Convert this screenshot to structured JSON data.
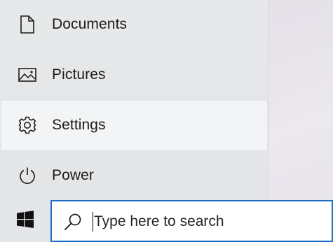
{
  "start_menu": {
    "items": [
      {
        "label": "Documents",
        "icon": "document-icon"
      },
      {
        "label": "Pictures",
        "icon": "pictures-icon"
      },
      {
        "label": "Settings",
        "icon": "gear-icon"
      },
      {
        "label": "Power",
        "icon": "power-icon"
      }
    ]
  },
  "taskbar": {
    "start_icon": "windows-logo-icon",
    "search": {
      "placeholder": "Type here to search",
      "value": "",
      "icon": "search-icon"
    }
  },
  "colors": {
    "accent": "#1f6fc4",
    "menu_bg": "#e5e7e9",
    "hover_bg": "#f3f4f5"
  }
}
